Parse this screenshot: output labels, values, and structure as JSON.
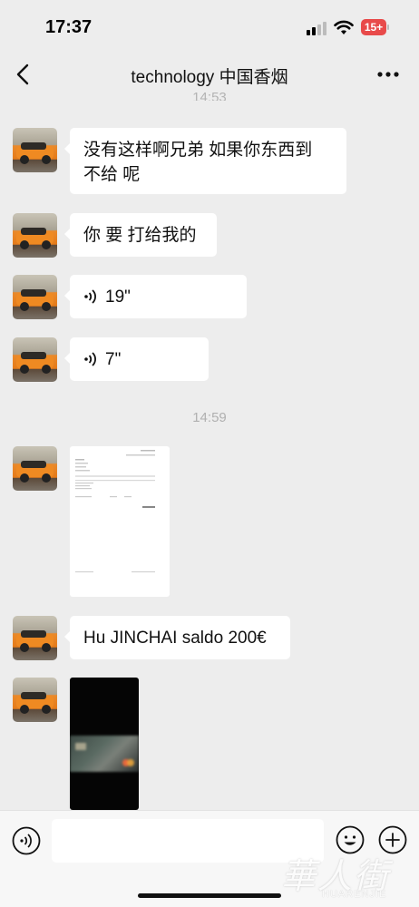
{
  "status_bar": {
    "time": "17:37",
    "battery": "15+"
  },
  "header": {
    "title": "technology 中国香烟",
    "partial_time": "14:53"
  },
  "messages": [
    {
      "type": "text",
      "text_line1": "没有这样啊兄弟 如果你东西到",
      "text_line2": "不给 呢"
    },
    {
      "type": "text",
      "text": "你 要 打给我的"
    },
    {
      "type": "voice",
      "duration": "19\""
    },
    {
      "type": "voice",
      "duration": "7\""
    },
    {
      "type": "timestamp",
      "text": "14:59"
    },
    {
      "type": "image",
      "icon": "invoice-document-thumbnail",
      "amount": "€ 200,00"
    },
    {
      "type": "text",
      "text": "Hu JINCHAI saldo 200€"
    },
    {
      "type": "image",
      "icon": "bank-card-photo-thumbnail"
    }
  ],
  "input_bar": {
    "placeholder": ""
  },
  "watermark": {
    "cn": "華人街",
    "en": "HUARENJIE"
  },
  "colors": {
    "background": "#ededed",
    "bubble": "#ffffff",
    "battery": "#e84a4a",
    "avatar_accent": "#e57b1a"
  }
}
